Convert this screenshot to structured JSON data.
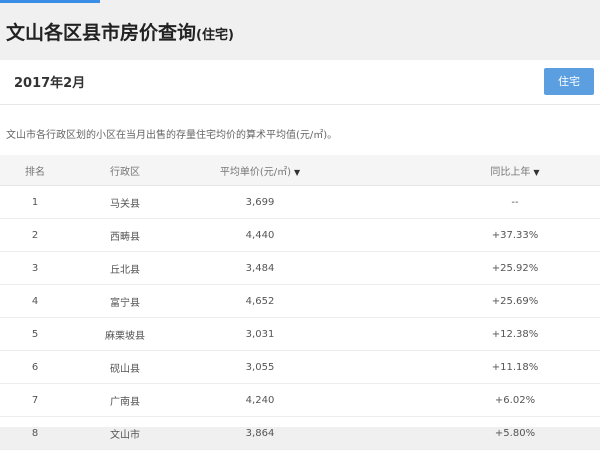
{
  "header": {
    "title": "文山各区县市房价查询",
    "title_suffix": "(住宅)"
  },
  "filter": {
    "month": "2017年2月",
    "type_button": "住宅"
  },
  "description": "文山市各行政区划的小区在当月出售的存量住宅均价的算术平均值(元/㎡)。",
  "table": {
    "columns": {
      "rank": "排名",
      "region": "行政区",
      "avg_price": "平均单价(元/㎡)",
      "yoy": "同比上年"
    },
    "rows": [
      {
        "rank": "1",
        "region": "马关县",
        "price": "3,699",
        "change": "--"
      },
      {
        "rank": "2",
        "region": "西畴县",
        "price": "4,440",
        "change": "+37.33%"
      },
      {
        "rank": "3",
        "region": "丘北县",
        "price": "3,484",
        "change": "+25.92%"
      },
      {
        "rank": "4",
        "region": "富宁县",
        "price": "4,652",
        "change": "+25.69%"
      },
      {
        "rank": "5",
        "region": "麻栗坡县",
        "price": "3,031",
        "change": "+12.38%"
      },
      {
        "rank": "6",
        "region": "砚山县",
        "price": "3,055",
        "change": "+11.18%"
      },
      {
        "rank": "7",
        "region": "广南县",
        "price": "4,240",
        "change": "+6.02%"
      },
      {
        "rank": "8",
        "region": "文山市",
        "price": "3,864",
        "change": "+5.80%"
      }
    ]
  },
  "colors": {
    "accent": "#3a8ee6",
    "link": "#2a6dc9",
    "up": "#e5524f"
  },
  "icons": {
    "sort": "caret-down-icon"
  }
}
